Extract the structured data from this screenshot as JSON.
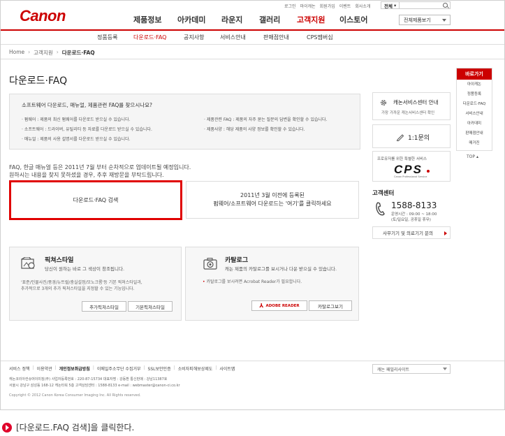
{
  "header": {
    "logo": "Canon",
    "util_links": [
      "로그인",
      "마이캐논",
      "회원가입",
      "이벤트",
      "회사소개"
    ],
    "search_scope": "전체",
    "search_value": "",
    "all_products": "전체제품보기",
    "main_nav": [
      {
        "label": "제품정보",
        "active": false
      },
      {
        "label": "아카데미",
        "active": false
      },
      {
        "label": "라운지",
        "active": false
      },
      {
        "label": "갤러리",
        "active": false
      },
      {
        "label": "고객지원",
        "active": true
      },
      {
        "label": "이스토어",
        "active": false
      }
    ],
    "sub_nav": [
      {
        "label": "정품등록",
        "active": false
      },
      {
        "label": "다운로드·FAQ",
        "active": true
      },
      {
        "label": "공지사항",
        "active": false
      },
      {
        "label": "서비스안내",
        "active": false
      },
      {
        "label": "판매점안내",
        "active": false
      },
      {
        "label": "CPS멤버십",
        "active": false
      }
    ]
  },
  "breadcrumb": [
    "Home",
    "고객지원",
    "다운로드·FAQ"
  ],
  "page_title": "다운로드·FAQ",
  "info": {
    "title": "소프트웨어 다운로드, 매뉴얼, 제품관련 FAQ를 찾으시나요?",
    "items_left": [
      "펌웨어 : 제품의 최신 펌웨어를 다운로드 받으실 수 있습니다.",
      "소프트웨어 : 드라이버, 유틸리티 등 자료를 다운로드 받으실 수 있습니다.",
      "매뉴얼 : 제품의 사용 설명서를 다운로드 받으실 수 있습니다."
    ],
    "items_right": [
      "제품관련 FAQ : 제품의 자주 묻는 질문의 답변을 확인할 수 있습니다.",
      "제품사양 : 해당 제품의 사양 정보를 확인할 수 있습니다."
    ]
  },
  "notice": {
    "line1": "FAQ, 한글 매뉴얼 등은 2011년 7월 부터 순차적으로 업데이트될 예정입니다.",
    "line2": "원하시는 내용을 찾지 못하셨을 경우, 추후 재방문을 부탁드립니다."
  },
  "faq_search_button": "다운로드·FAQ 검색",
  "old_products": {
    "line1": "2011년 3월 이전에 등록된",
    "line2": "펌웨어/소프트웨어 다운로드는 '여기'를 클릭하세요"
  },
  "picture_style": {
    "title": "픽쳐스타일",
    "subtitle": "당신이 원하는 바로 그 색상이 창조됩니다.",
    "desc1": "'표준/인물사진/풍경/뉴트럴/충실설정/모노크롬'등 기본 픽쳐스타일과,",
    "desc2": "추가적으로 3개의 추가 픽쳐스타일을 지정할 수 있는 기능입니다.",
    "btn_add": "추가픽쳐스타일",
    "btn_basic": "기본픽쳐스타일"
  },
  "catalog": {
    "title": "카탈로그",
    "subtitle": "캐논 제품의 카탈로그를 보시거나 다운 받으실 수 있습니다.",
    "note": "카탈로그를 보시려면 Acrobat Reader가 필요합니다.",
    "btn_adobe": "ADOBE READER",
    "btn_view": "카탈로그보기"
  },
  "sidebar": {
    "center_title": "캐논서비스센터 안내",
    "center_sub": "가장 가까운 캐논서비스센터 확인",
    "inquiry": "1:1문의",
    "cps_caption": "프로유저를 위한 특별한 서비스",
    "cps_logo": "CPS",
    "cps_small": "Canon Professional Service",
    "customer_title": "고객센터",
    "phone": "1588-8133",
    "hours1": "운영시간 : 09:00 ~ 18:00",
    "hours2": "(토/일요일, 공휴일 휴무)",
    "business": "사무기기 및 의료기기 문의"
  },
  "quick": {
    "title": "바로가기",
    "items": [
      "아이캐논",
      "정품등록",
      "다운로드·FAQ",
      "서비스안내",
      "아카데미",
      "판매점안내",
      "매거진"
    ],
    "top": "TOP"
  },
  "footer": {
    "links": [
      {
        "label": "서비스 정책",
        "bold": false
      },
      {
        "label": "이용약관",
        "bold": false
      },
      {
        "label": "개인정보취급방침",
        "bold": true
      },
      {
        "label": "이메일주소무단 수집거부",
        "bold": false
      },
      {
        "label": "SSL보안인증",
        "bold": false
      },
      {
        "label": "소비자피해보상제도",
        "bold": false
      },
      {
        "label": "사이트맵",
        "bold": false
      }
    ],
    "family_site": "캐논 패밀리사이트",
    "info1": "캐논코리아컨슈머이미징(주)   사업자등록번호 : 220-87-15734   대표자명 : 강동환   통신판매 : 강남11387호",
    "info2": "서울시 강남구 삼성동 168-12 캐논타워 5층   고객상담센터 : 1588-8133   e-mail : webmaster@canon-ci.co.kr",
    "copyright": "Copyright © 2012 Canon Korea Consumer Imaging Inc. All Rights reserved."
  },
  "caption": "[다운로드.FAQ 검색]을 클릭한다."
}
